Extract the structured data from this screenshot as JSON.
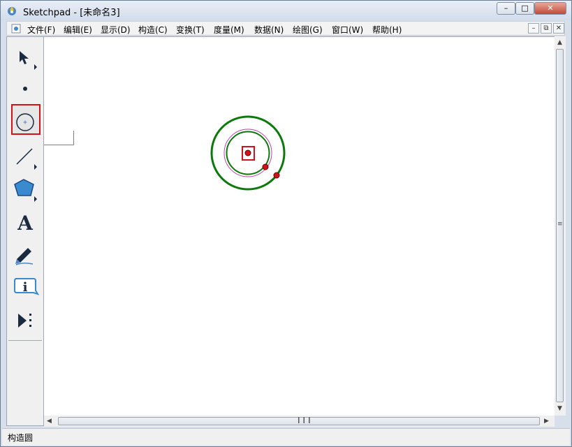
{
  "window": {
    "title": "Sketchpad  - [未命名3]"
  },
  "menubar": {
    "items": [
      "文件(F)",
      "编辑(E)",
      "显示(D)",
      "构造(C)",
      "变换(T)",
      "度量(M)",
      "数据(N)",
      "绘图(G)",
      "窗口(W)",
      "帮助(H)"
    ]
  },
  "toolbox": {
    "tools": [
      {
        "name": "arrow-select-tool",
        "icon": "arrow-icon"
      },
      {
        "name": "point-tool",
        "icon": "point-icon"
      },
      {
        "name": "compass-tool",
        "icon": "circle-icon",
        "selected": true
      },
      {
        "name": "straightedge-tool",
        "icon": "segment-icon"
      },
      {
        "name": "polygon-tool",
        "icon": "pentagon-icon"
      },
      {
        "name": "text-tool",
        "icon": "text-a-icon",
        "label": "A"
      },
      {
        "name": "marker-tool",
        "icon": "marker-icon"
      },
      {
        "name": "information-tool",
        "icon": "info-icon",
        "label": "i"
      },
      {
        "name": "custom-tool",
        "icon": "play-dots-icon"
      }
    ]
  },
  "status": {
    "text": "构造圆"
  },
  "colors": {
    "highlight": "#d0121a",
    "circle_outer": "#0b7a0b",
    "circle_inner_pink": "#c040b0",
    "point": "#d0121a"
  }
}
